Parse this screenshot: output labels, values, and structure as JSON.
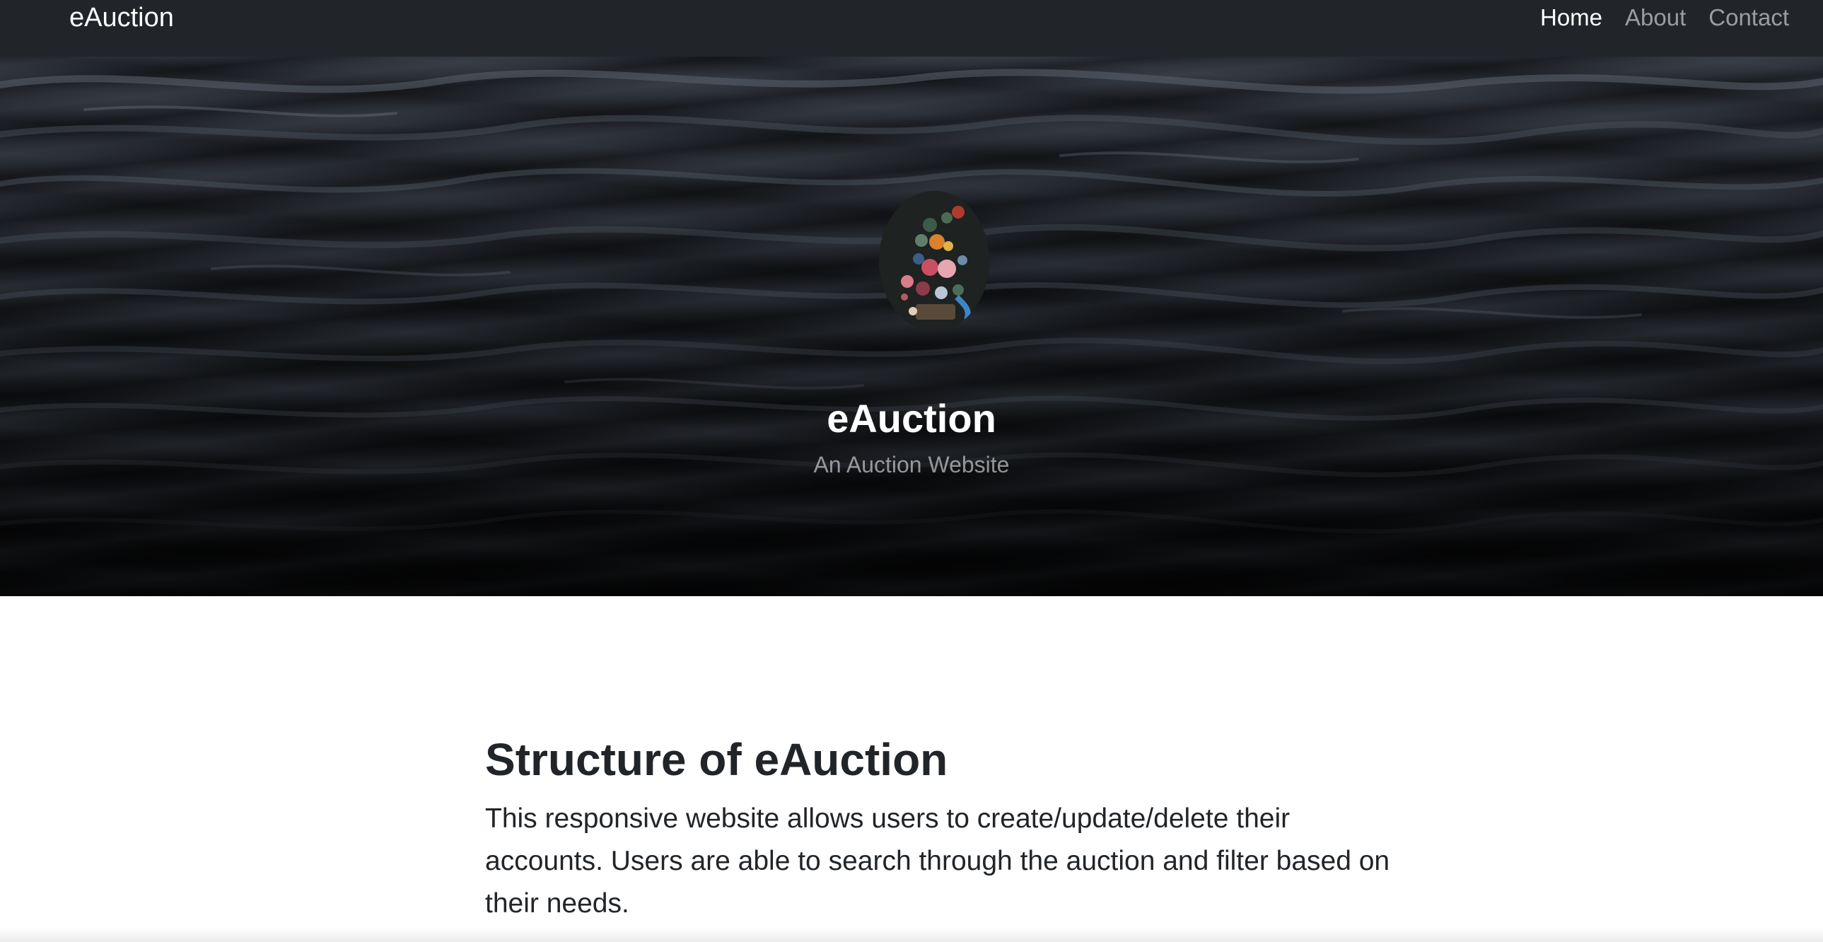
{
  "navbar": {
    "brand": "eAuction",
    "links": [
      {
        "label": "Home",
        "active": true
      },
      {
        "label": "About",
        "active": false
      },
      {
        "label": "Contact",
        "active": false
      }
    ],
    "background": "#212529"
  },
  "hero": {
    "avatar_icon": "floral-painting-avatar",
    "title": "eAuction",
    "subtitle": "An Auction Website"
  },
  "main": {
    "heading": "Structure of eAuction",
    "paragraph": "This responsive website allows users to create/update/delete their accounts. Users are able to search through the auction and filter based on their needs."
  },
  "colors": {
    "nav_bg": "#212529",
    "text_dark": "#212529",
    "hero_dark": "#17191d"
  }
}
